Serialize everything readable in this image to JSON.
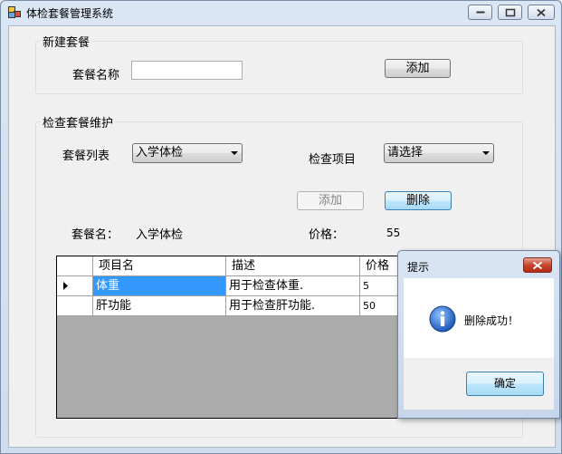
{
  "window": {
    "title": "体检套餐管理系统"
  },
  "new_package": {
    "group_label": "新建套餐",
    "name_label": "套餐名称",
    "name_value": "",
    "add_label": "添加"
  },
  "maintain": {
    "group_label": "检查套餐维护",
    "list_label": "套餐列表",
    "list_selected": "入学体检",
    "item_label": "检查项目",
    "item_selected": "请选择",
    "add_label": "添加",
    "delete_label": "删除",
    "pkg_name_label": "套餐名：",
    "pkg_name_value": "入学体检",
    "price_label": "价格：",
    "price_value": "55"
  },
  "table": {
    "columns": [
      "项目名",
      "描述",
      "价格"
    ],
    "rows": [
      {
        "name": "体重",
        "desc": "用于检查体重.",
        "price": "5"
      },
      {
        "name": "肝功能",
        "desc": "用于检查肝功能.",
        "price": "50"
      }
    ]
  },
  "dialog": {
    "title": "提示",
    "message": "删除成功！",
    "ok_label": "确定"
  },
  "colors": {
    "selection": "#3399ff",
    "grid_background": "#ababab",
    "close_button": "#c7452c"
  }
}
